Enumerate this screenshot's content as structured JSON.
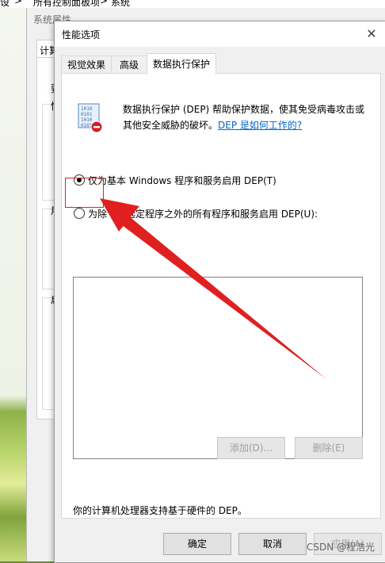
{
  "breadcrumb": {
    "items": [
      "设",
      "所有控制面板项",
      "系统"
    ],
    "separator": ">"
  },
  "system_properties": {
    "title": "系统属性",
    "tab_label": "计算",
    "left_labels": [
      "要",
      "性",
      "用",
      "启"
    ]
  },
  "dialog": {
    "title": "性能选项",
    "close_symbol": "✕",
    "tabs": [
      {
        "label": "视觉效果"
      },
      {
        "label": "高级"
      },
      {
        "label": "数据执行保护"
      }
    ],
    "active_tab": "数据执行保护",
    "description": "数据执行保护 (DEP) 帮助保护数据，使其免受病毒攻击或其他安全威胁的破坏。",
    "link_text": "DEP 是如何工作的?",
    "options": [
      {
        "label": "仅为基本 Windows 程序和服务启用 DEP(T)",
        "selected": true
      },
      {
        "label": "为除下列选定程序之外的所有程序和服务启用 DEP(U):",
        "selected": false
      }
    ],
    "add_button": "添加(D)...",
    "remove_button": "删除(E)",
    "support_text": "你的计算机处理器支持基于硬件的 DEP。",
    "ok_button": "确定",
    "cancel_button": "取消",
    "apply_button": "应用(A)"
  },
  "watermark": "CSDN @程浩光",
  "colors": {
    "annotation_red": "#e02020",
    "link_blue": "#0066cc"
  }
}
